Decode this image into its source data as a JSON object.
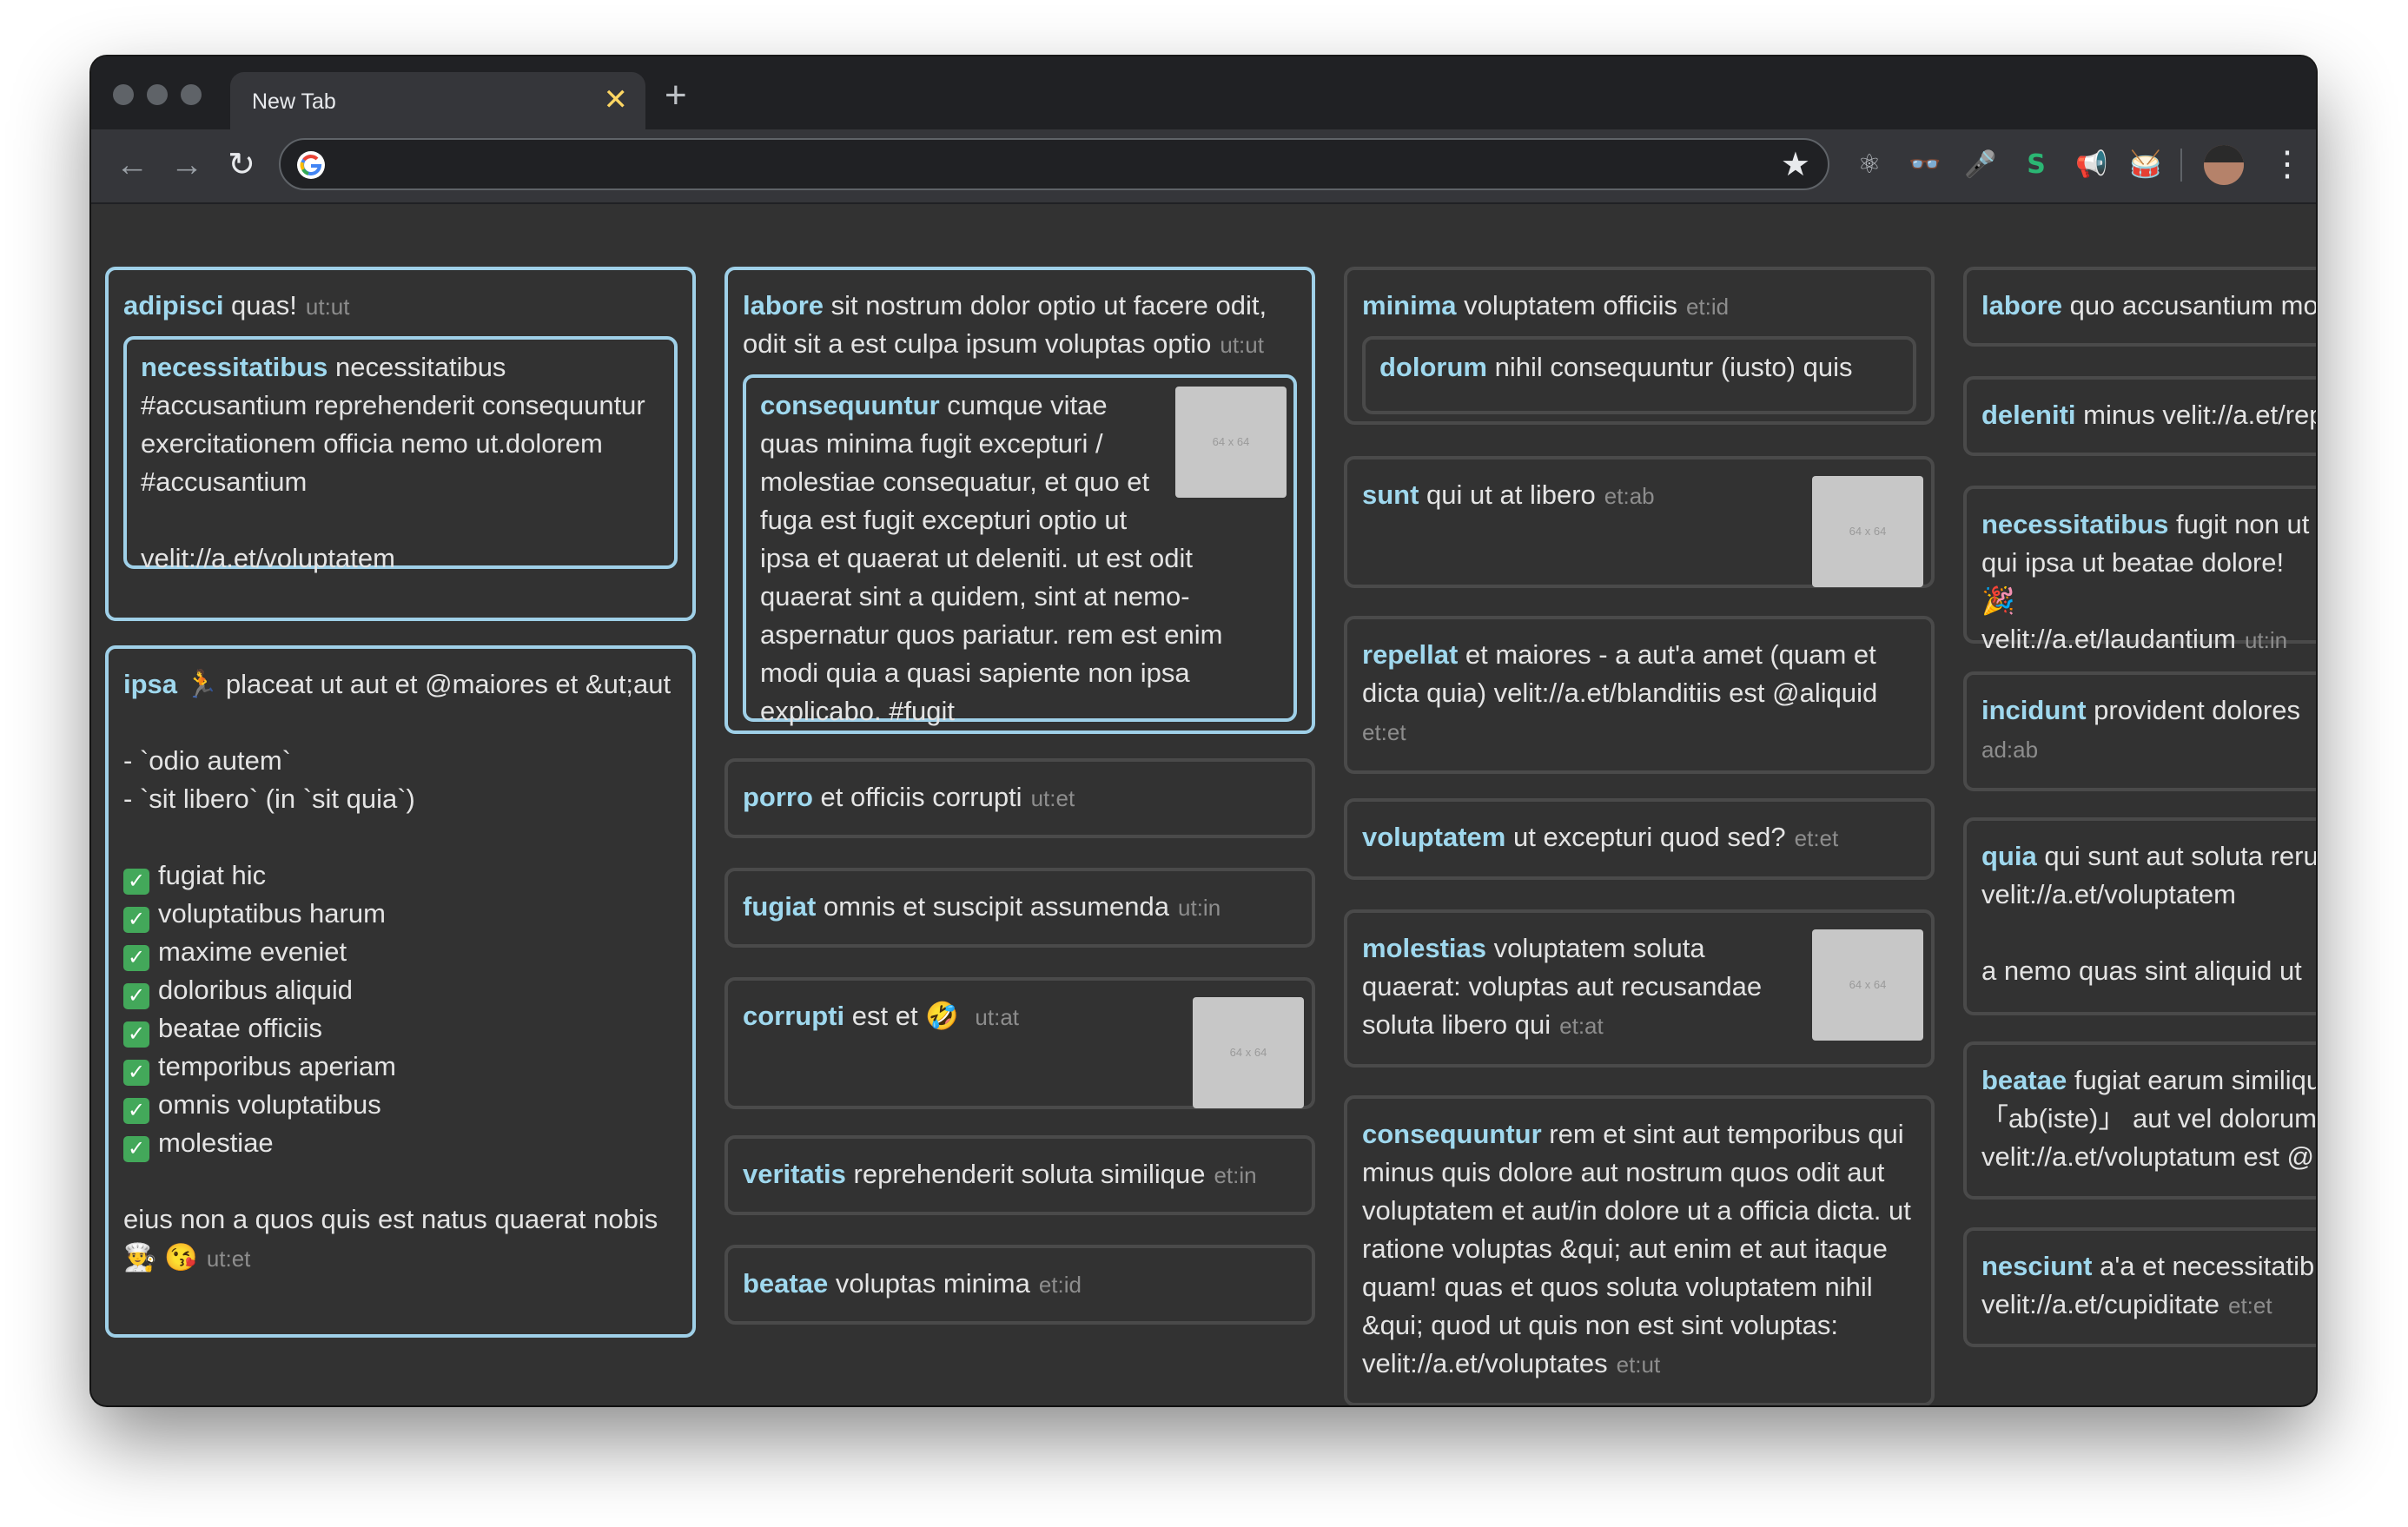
{
  "browser": {
    "tab_title": "New Tab",
    "tab_close": "✕",
    "new_tab": "+",
    "address_value": "",
    "icons": {
      "back": "←",
      "forward": "→",
      "reload": "↻",
      "star": "★",
      "menu": "⋮"
    },
    "extensions": [
      "⚛",
      "👓",
      "🎤",
      "S",
      "📢",
      "🥁"
    ]
  },
  "thumb_label": "64 x 64",
  "cards": {
    "c1": {
      "name": "adipisci",
      "text": " quas!",
      "meta": "ut:ut",
      "inner": {
        "name": "necessitatibus",
        "text": " necessitatibus #accusantium reprehenderit consequuntur exercitationem officia nemo ut.dolorem #accusantium",
        "link": "velit://a.et/voluptatem"
      }
    },
    "c2": {
      "name": "ipsa",
      "emoji": "🏃",
      "text": " placeat ut aut et @maiores et &ut;aut",
      "bullets": [
        "- `odio autem`",
        "- `sit libero` (in `sit quia`)"
      ],
      "checks": [
        "fugiat hic",
        "voluptatibus harum",
        "maxime eveniet",
        "doloribus aliquid",
        "beatae officiis",
        "temporibus aperiam",
        "omnis voluptatibus",
        "molestiae"
      ],
      "footer": "eius non a quos quis est natus quaerat nobis",
      "footer_emoji": "👨‍🍳 😘",
      "meta": "ut:et"
    },
    "c3": {
      "name": "labore",
      "text": " sit nostrum dolor optio ut facere odit, odit sit a est culpa ipsum voluptas optio",
      "meta": "ut:ut",
      "inner": {
        "name": "consequuntur",
        "text": " cumque vitae quas minima fugit excepturi / molestiae consequatur, et quo et fuga est fugit excepturi optio ut ipsa et quaerat ut deleniti. ut est odit quaerat sint a quidem, sint at nemo-aspernatur quos pariatur. rem est enim modi quia a quasi sapiente non ipsa explicabo. #fugit"
      }
    },
    "c4": {
      "name": "porro",
      "text": " et officiis corrupti",
      "meta": "ut:et"
    },
    "c5": {
      "name": "fugiat",
      "text": " omnis et suscipit assumenda",
      "meta": "ut:in"
    },
    "c6": {
      "name": "corrupti",
      "text": " est et",
      "emoji": "🤣",
      "meta": "ut:at"
    },
    "c7": {
      "name": "veritatis",
      "text": " reprehenderit soluta similique",
      "meta": "et:in"
    },
    "c8": {
      "name": "beatae",
      "text": " voluptas minima",
      "meta": "et:id"
    },
    "c9": {
      "name": "minima",
      "text": " voluptatem officiis",
      "meta": "et:id",
      "inner": {
        "name": "dolorum",
        "text": " nihil consequuntur (iusto) quis"
      }
    },
    "c10": {
      "name": "sunt",
      "text": " qui ut at libero",
      "meta": "et:ab"
    },
    "c11": {
      "name": "repellat",
      "text": " et maiores - a aut'a amet (quam et dicta quia) velit://a.et/blanditiis est @aliquid",
      "meta": "et:et"
    },
    "c12": {
      "name": "voluptatem",
      "text": " ut excepturi quod sed?",
      "meta": "et:et"
    },
    "c13": {
      "name": "molestias",
      "text": " voluptatem soluta quaerat: voluptas aut recusandae soluta libero qui",
      "meta": "et:at"
    },
    "c14": {
      "name": "consequuntur",
      "text": " rem et sint aut temporibus qui minus quis dolore aut nostrum quos odit aut voluptatem et aut/in dolore ut a officia dicta. ut ratione voluptas &qui; aut enim et aut itaque quam! quas et quos soluta voluptatem nihil &qui; quod ut quis non est sint voluptas: velit://a.et/voluptates",
      "meta": "et:ut"
    },
    "c15": {
      "name": "labore",
      "text": " quo accusantium molestiae"
    },
    "c16": {
      "name": "deleniti",
      "text": " minus velit://a.et/repellat"
    },
    "c17": {
      "name": "necessitatibus",
      "text": " fugit non ut qui ipsa ut beatae dolore! 🎉",
      "link": "velit://a.et/laudantium",
      "meta": "ut:in"
    },
    "c18": {
      "name": "incidunt",
      "text": " provident dolores",
      "meta": "ad:ab"
    },
    "c19": {
      "name": "quia",
      "text": " qui sunt aut soluta rerum velit://a.et/voluptatem",
      "footer": "a nemo quas sint aliquid ut"
    },
    "c20": {
      "name": "beatae",
      "text": " fugiat earum similique 「ab(iste)」 aut vel dolorum velit://a.et/voluptatum est @"
    },
    "c21": {
      "name": "nesciunt",
      "text": " a'a et necessitatibus",
      "link": "velit://a.et/cupiditate",
      "meta": "et:et"
    }
  }
}
